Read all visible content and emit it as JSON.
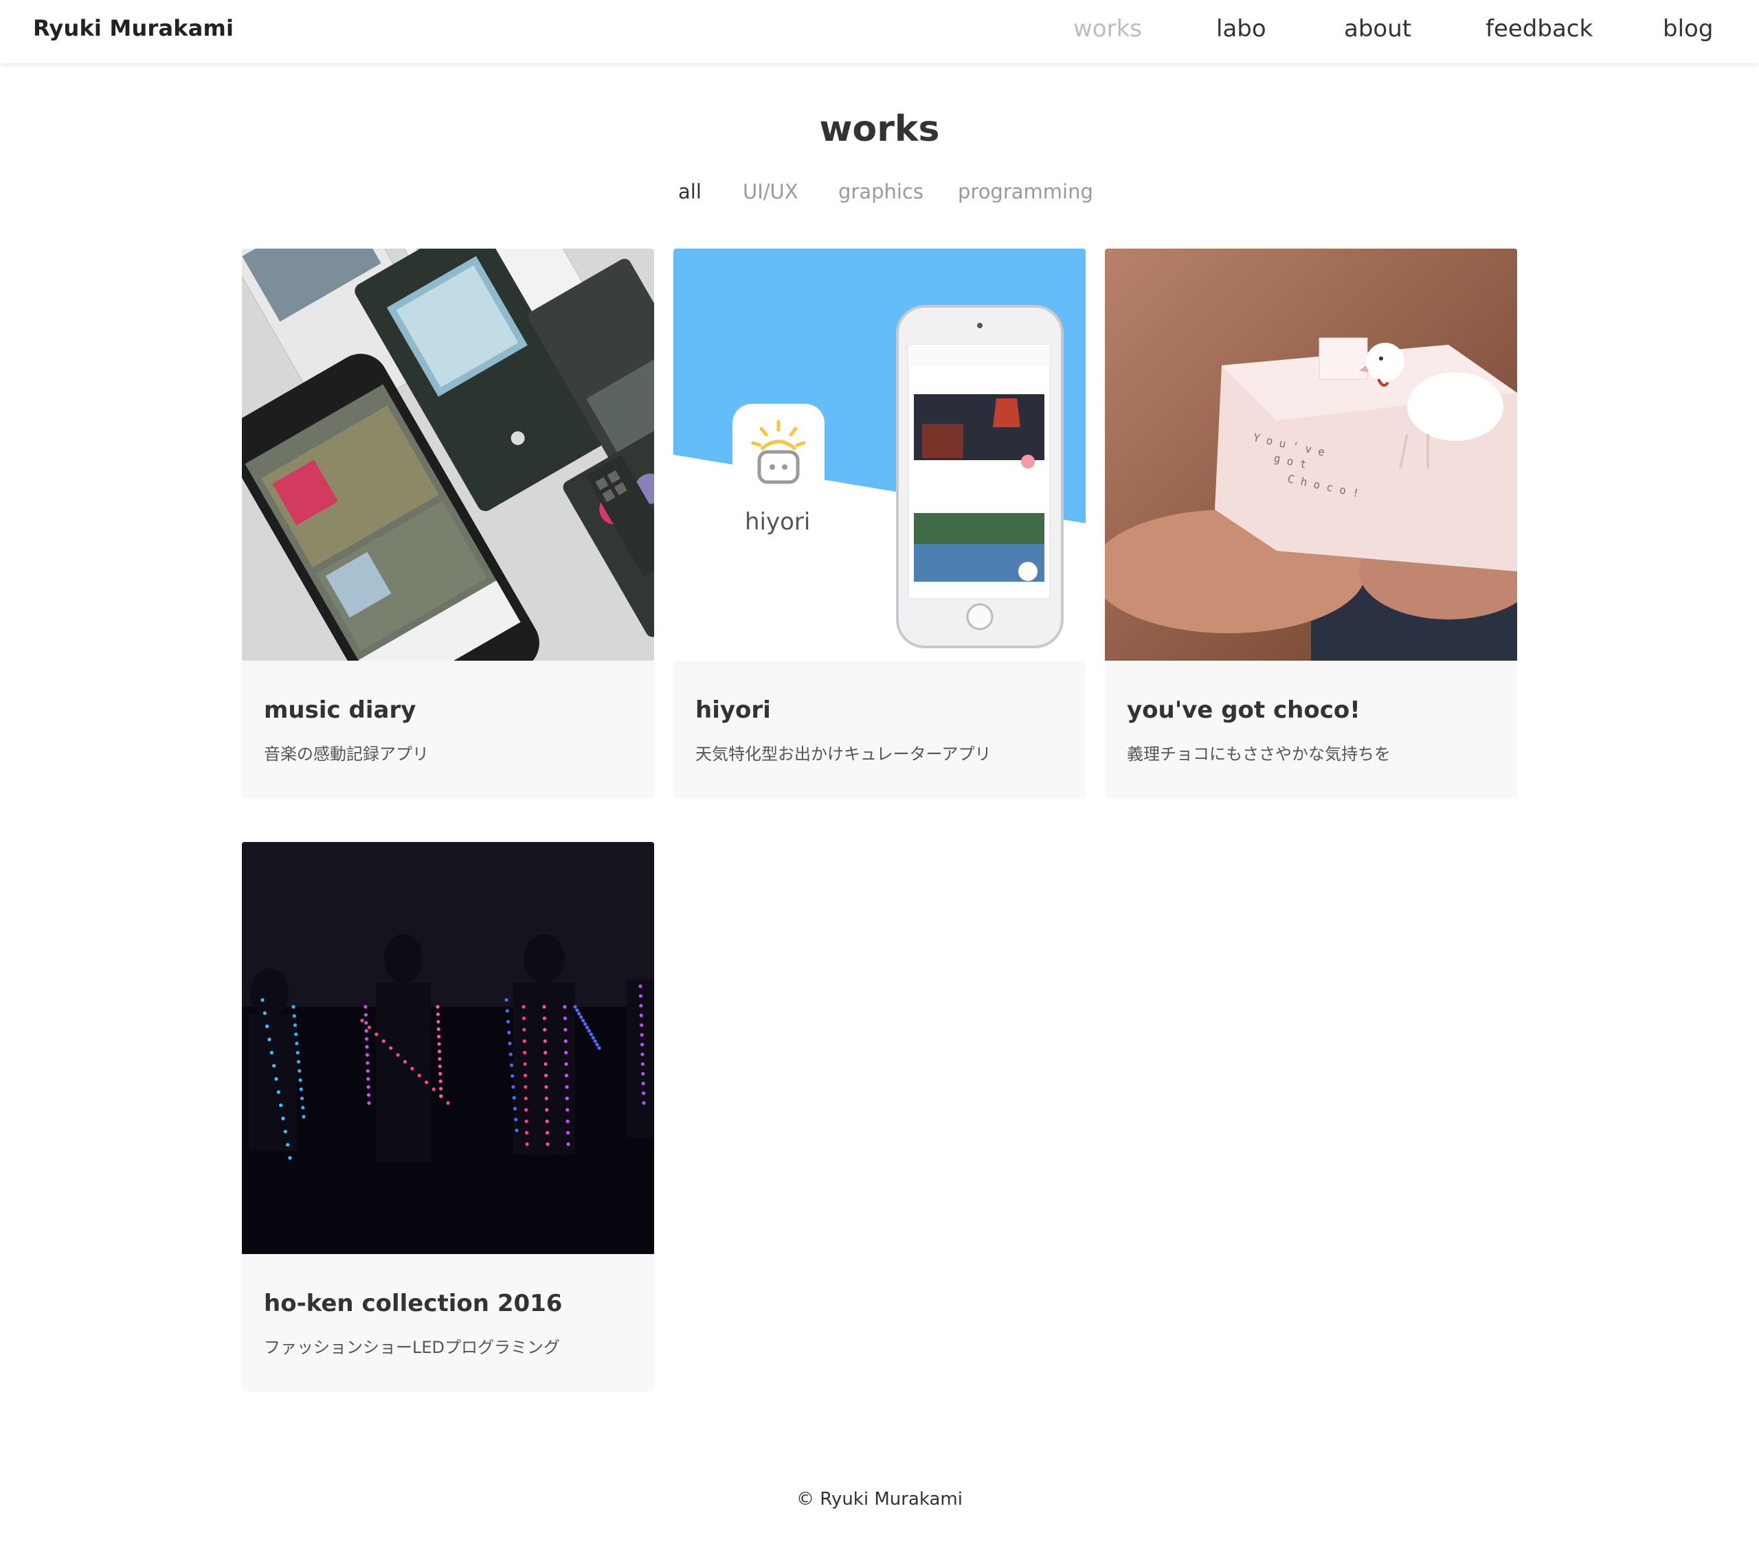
{
  "header": {
    "brand": "Ryuki Murakami",
    "nav": [
      {
        "label": "works",
        "active": true
      },
      {
        "label": "labo",
        "active": false
      },
      {
        "label": "about",
        "active": false
      },
      {
        "label": "feedback",
        "active": false
      },
      {
        "label": "blog",
        "active": false
      }
    ]
  },
  "page": {
    "title": "works",
    "filters": [
      {
        "label": "all",
        "active": true
      },
      {
        "label": "UI/UX",
        "active": false
      },
      {
        "label": "graphics",
        "active": false
      },
      {
        "label": "programming",
        "active": false
      }
    ]
  },
  "works": [
    {
      "title": "music diary",
      "subtitle": "音楽の感動記録アプリ"
    },
    {
      "title": "hiyori",
      "subtitle": "天気特化型お出かけキュレーターアプリ",
      "app_name": "hiyori"
    },
    {
      "title": "you've got choco!",
      "subtitle": "義理チョコにもささやかな気持ちを"
    },
    {
      "title": "ho-ken collection 2016",
      "subtitle": "ファッションショーLEDプログラミング"
    }
  ],
  "footer": {
    "copyright": "© Ryuki Murakami"
  },
  "colors": {
    "nav_active": "#bdbdbd",
    "text": "#333333",
    "card_bg": "#f8f8f8",
    "hiyori_blue": "#64bdf8"
  }
}
